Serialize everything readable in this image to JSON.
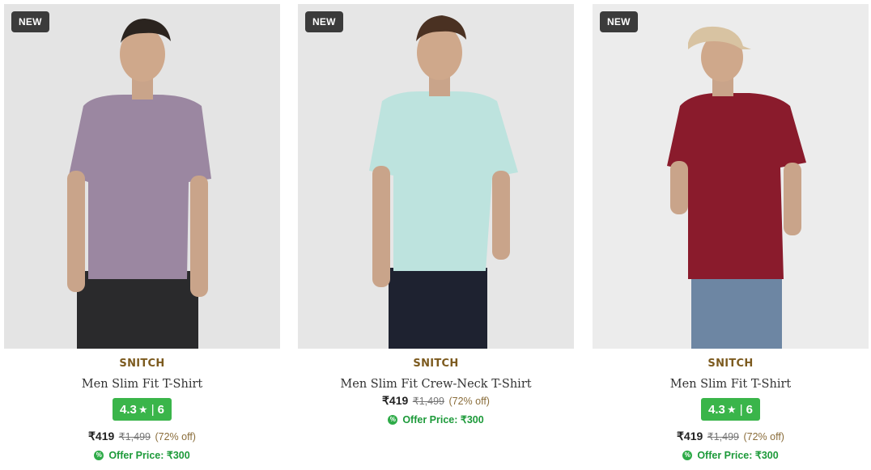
{
  "products": [
    {
      "badge": "NEW",
      "brand": "SNITCH",
      "title": "Men Slim Fit T-Shirt",
      "rating": "4.3",
      "rating_count": "6",
      "price": "₹419",
      "mrp": "₹1,499",
      "discount": "(72% off)",
      "offer": "Offer Price: ₹300",
      "shirt_color": "#9b87a1",
      "pants_color": "#2a2a2c",
      "has_rating": true
    },
    {
      "badge": "NEW",
      "brand": "SNITCH",
      "title": "Men Slim Fit Crew-Neck T-Shirt",
      "price": "₹419",
      "mrp": "₹1,499",
      "discount": "(72% off)",
      "offer": "Offer Price: ₹300",
      "shirt_color": "#bde3de",
      "pants_color": "#1e2230",
      "has_rating": false
    },
    {
      "badge": "NEW",
      "brand": "SNITCH",
      "title": "Men Slim Fit T-Shirt",
      "rating": "4.3",
      "rating_count": "6",
      "price": "₹419",
      "mrp": "₹1,499",
      "discount": "(72% off)",
      "offer": "Offer Price: ₹300",
      "shirt_color": "#8a1b2c",
      "pants_color": "#6d86a3",
      "has_rating": true
    }
  ],
  "icons": {
    "star": "star-icon",
    "offer": "percent-badge-icon"
  },
  "colors": {
    "rating_bg": "#3ab54a",
    "offer_text": "#1d9a3a",
    "brand_text": "#7c5a1e",
    "badge_bg": "#3b3b3b"
  }
}
